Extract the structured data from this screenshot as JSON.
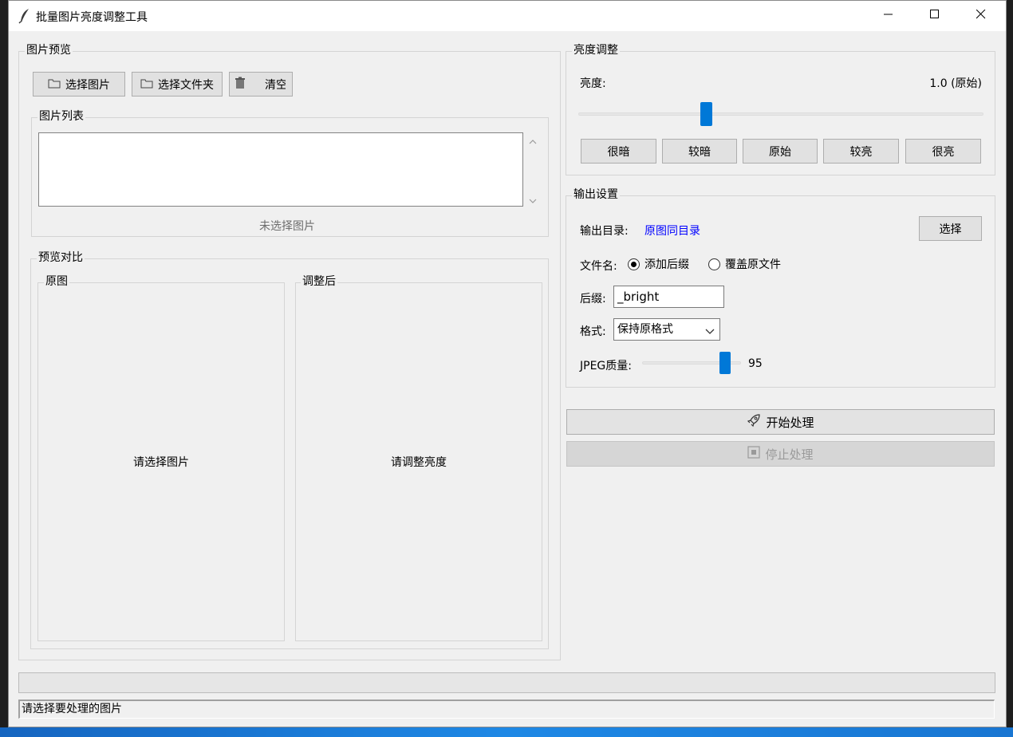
{
  "window": {
    "title": "批量图片亮度调整工具",
    "icon": "feather-icon",
    "controls": [
      "minimize-icon",
      "maximize-icon",
      "close-icon"
    ]
  },
  "preview_panel": {
    "label": "图片预览",
    "buttons": {
      "select_image": "选择图片",
      "select_folder": "选择文件夹",
      "clear": "清空"
    },
    "image_list": {
      "label": "图片列表",
      "items": [],
      "empty_text": "未选择图片"
    },
    "compare": {
      "label": "预览对比",
      "original": {
        "label": "原图",
        "placeholder": "请选择图片"
      },
      "adjusted": {
        "label": "调整后",
        "placeholder": "请调整亮度"
      }
    }
  },
  "brightness": {
    "label": "亮度调整",
    "field_label": "亮度:",
    "value_text": "1.0 (原始)",
    "slider_level": 0.31,
    "presets": [
      "很暗",
      "较暗",
      "原始",
      "较亮",
      "很亮"
    ]
  },
  "output": {
    "label": "输出设置",
    "dir_label": "输出目录:",
    "dir_value": "原图同目录",
    "choose_button": "选择",
    "filename_label": "文件名:",
    "radio_suffix": "添加后缀",
    "radio_overwrite": "覆盖原文件",
    "radio_selected": "suffix",
    "suffix_label": "后缀:",
    "suffix_value": "_bright",
    "format_label": "格式:",
    "format_value": "保持原格式",
    "quality_label": "JPEG质量:",
    "quality_value": "95",
    "quality_level": 0.88
  },
  "actions": {
    "start": "开始处理",
    "start_icon": "rocket-icon",
    "stop": "停止处理",
    "stop_icon": "stop-icon"
  },
  "progress": {
    "value": 0
  },
  "status": {
    "text": "请选择要处理的图片"
  },
  "colors": {
    "accent": "#0078d7",
    "link": "#0000ff",
    "window_bg": "#f0f0f0"
  }
}
